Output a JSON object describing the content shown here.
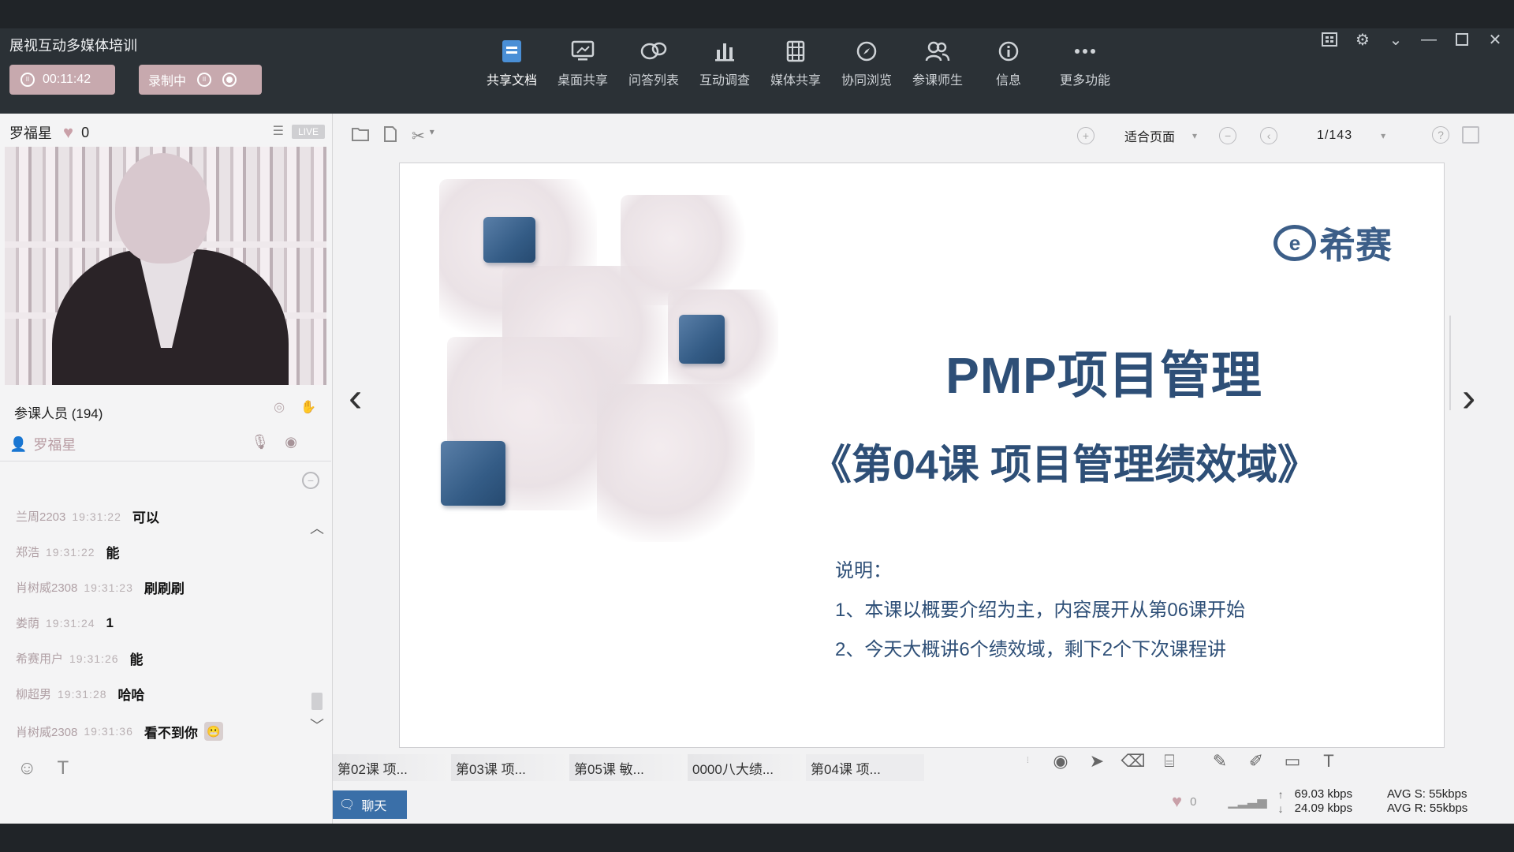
{
  "app": {
    "title": "展视互动多媒体培训",
    "timer": "00:11:42",
    "recording_label": "录制中"
  },
  "toolbar": {
    "items": [
      {
        "label": "共享文档",
        "icon": "document-icon",
        "active": true
      },
      {
        "label": "桌面共享",
        "icon": "desktop-share-icon",
        "active": false
      },
      {
        "label": "问答列表",
        "icon": "qa-chat-icon",
        "active": false
      },
      {
        "label": "互动调查",
        "icon": "bar-chart-icon",
        "active": false
      },
      {
        "label": "媒体共享",
        "icon": "film-icon",
        "active": false
      },
      {
        "label": "协同浏览",
        "icon": "compass-icon",
        "active": false
      },
      {
        "label": "参课师生",
        "icon": "users-icon",
        "active": false
      },
      {
        "label": "信息",
        "icon": "info-icon",
        "active": false
      },
      {
        "label": "更多功能",
        "icon": "more-icon",
        "active": false
      }
    ]
  },
  "presenter": {
    "name": "罗福星",
    "likes": "0",
    "live_badge": "LIVE"
  },
  "attendees": {
    "label": "参课人员",
    "count": "(194)",
    "presenter_name": "罗福星"
  },
  "chat": {
    "messages": [
      {
        "who": "兰周2203",
        "time": "19:31:22",
        "text": "可以"
      },
      {
        "who": "郑浩",
        "time": "19:31:22",
        "text": "能"
      },
      {
        "who": "肖树威2308",
        "time": "19:31:23",
        "text": "刷刷刷"
      },
      {
        "who": "娄荫",
        "time": "19:31:24",
        "text": "1"
      },
      {
        "who": "希赛用户",
        "time": "19:31:26",
        "text": "能"
      },
      {
        "who": "柳超男",
        "time": "19:31:28",
        "text": "哈哈"
      },
      {
        "who": "肖树威2308",
        "time": "19:31:36",
        "text": "看不到你"
      }
    ],
    "tab_label": "聊天"
  },
  "doc_toolbar": {
    "zoom_label": "适合页面",
    "page_label": "1/143"
  },
  "slide": {
    "brand": "希赛",
    "title": "PMP项目管理",
    "subtitle": "《第04课 项目管理绩效域》",
    "note_heading": "说明：",
    "note_1": "1、本课以概要介绍为主，内容展开从第06课开始",
    "note_2": "2、今天大概讲6个绩效域，剩下2个下次课程讲",
    "colors": {
      "accent": "#2e4f77",
      "square": "#345c86"
    }
  },
  "doc_tabs": [
    {
      "label": "第02课 项..."
    },
    {
      "label": "第03课 项..."
    },
    {
      "label": "第05课 敏..."
    },
    {
      "label": "0000八大绩..."
    },
    {
      "label": "第04课 项..."
    }
  ],
  "status": {
    "likes": "0",
    "up_rate": "69.03 kbps",
    "down_rate": "24.09 kbps",
    "avg_send": "AVG S: 55kbps",
    "avg_recv": "AVG R: 55kbps"
  }
}
